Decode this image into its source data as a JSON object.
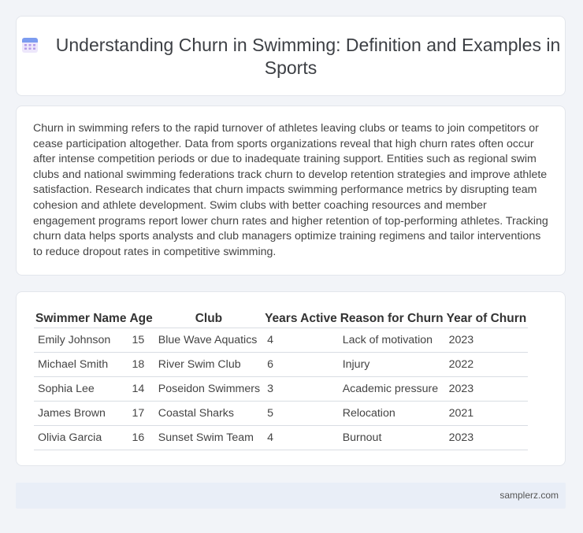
{
  "header": {
    "title": "Understanding Churn in Swimming: Definition and Examples in Sports",
    "icon": "calendar-icon"
  },
  "description": "Churn in swimming refers to the rapid turnover of athletes leaving clubs or teams to join competitors or cease participation altogether. Data from sports organizations reveal that high churn rates often occur after intense competition periods or due to inadequate training support. Entities such as regional swim clubs and national swimming federations track churn to develop retention strategies and improve athlete satisfaction. Research indicates that churn impacts swimming performance metrics by disrupting team cohesion and athlete development. Swim clubs with better coaching resources and member engagement programs report lower churn rates and higher retention of top-performing athletes. Tracking churn data helps sports analysts and club managers optimize training regimens and tailor interventions to reduce dropout rates in competitive swimming.",
  "table": {
    "headers": [
      "Swimmer Name",
      "Age",
      "Club",
      "Years Active",
      "Reason for Churn",
      "Year of Churn"
    ],
    "rows": [
      [
        "Emily Johnson",
        "15",
        "Blue Wave Aquatics",
        "4",
        "Lack of motivation",
        "2023"
      ],
      [
        "Michael Smith",
        "18",
        "River Swim Club",
        "6",
        "Injury",
        "2022"
      ],
      [
        "Sophia Lee",
        "14",
        "Poseidon Swimmers",
        "3",
        "Academic pressure",
        "2023"
      ],
      [
        "James Brown",
        "17",
        "Coastal Sharks",
        "5",
        "Relocation",
        "2021"
      ],
      [
        "Olivia Garcia",
        "16",
        "Sunset Swim Team",
        "4",
        "Burnout",
        "2023"
      ]
    ]
  },
  "footer": {
    "text": "samplerz.com"
  },
  "colors": {
    "background": "#f2f4f8",
    "card": "#ffffff",
    "footer": "#e9eef7",
    "icon": "#a78bfa"
  }
}
